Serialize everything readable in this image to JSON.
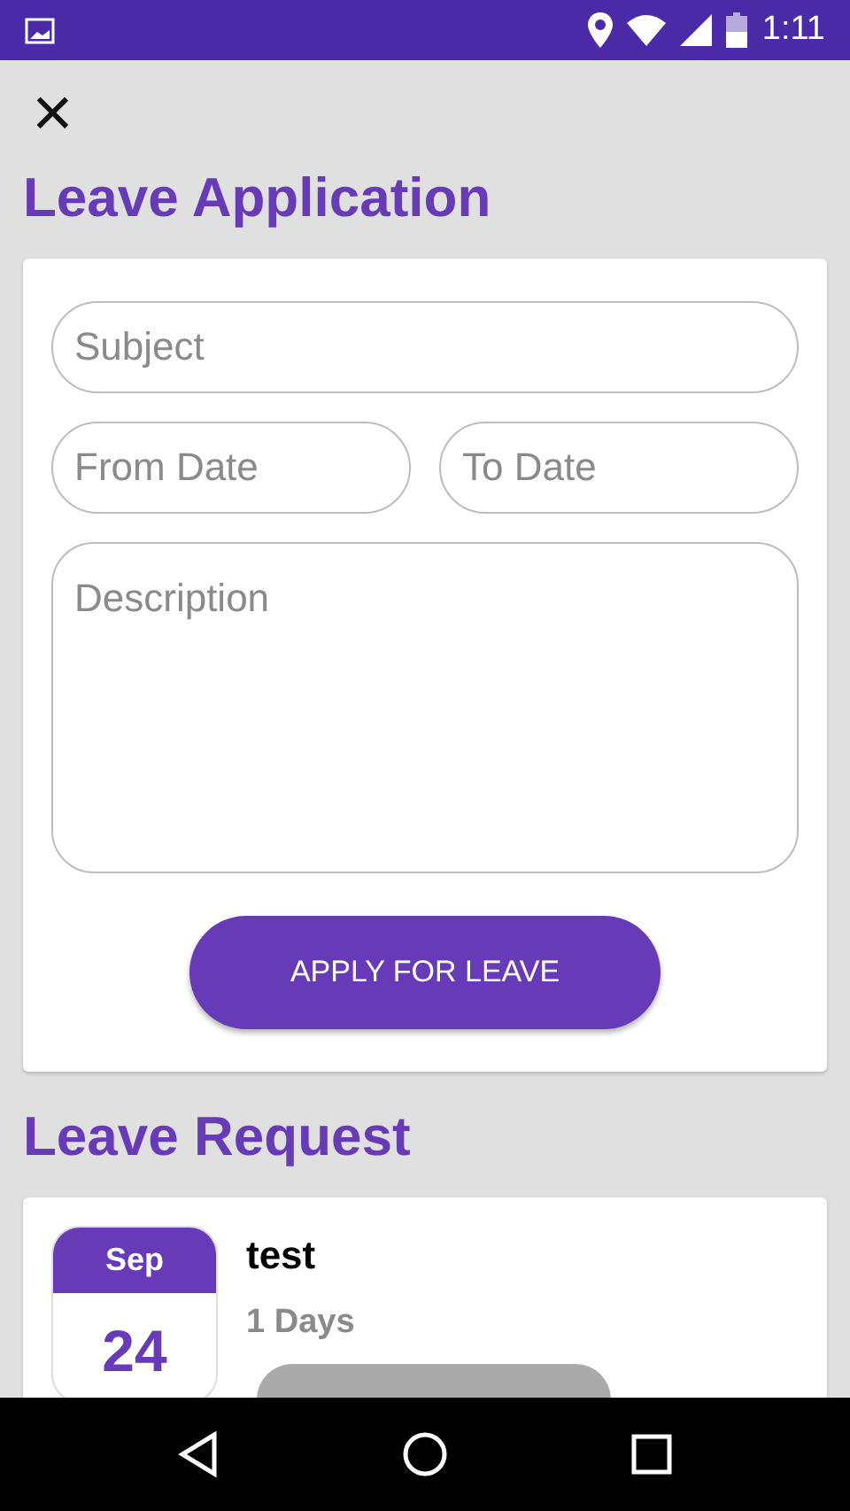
{
  "status_bar": {
    "time": "1:11"
  },
  "close_button": {
    "label": "×"
  },
  "form": {
    "title": "Leave Application",
    "fields": [
      {
        "placeholder": "Subject",
        "kind": "line"
      },
      {
        "placeholder": "From Date",
        "kind": "half"
      },
      {
        "placeholder": "To Date",
        "kind": "half"
      },
      {
        "placeholder": "Description",
        "kind": "area"
      }
    ],
    "submit": "APPLY FOR LEAVE"
  },
  "requests": {
    "title": "Leave Request",
    "items": [
      {
        "month": "Sep",
        "day": "24",
        "subject": "test",
        "duration": "1 Days"
      }
    ]
  }
}
